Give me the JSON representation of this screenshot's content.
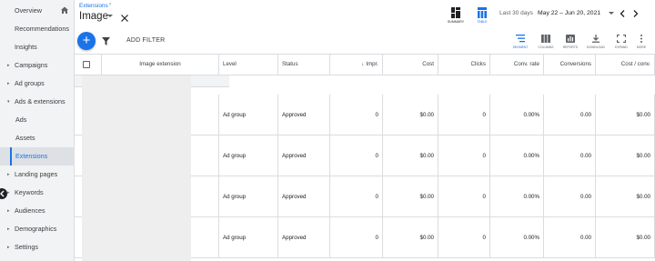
{
  "sidebar": {
    "items": [
      {
        "label": "Overview",
        "caret": false,
        "active": false
      },
      {
        "label": "Recommendations",
        "caret": false,
        "active": false
      },
      {
        "label": "Insights",
        "caret": false,
        "active": false
      },
      {
        "label": "Campaigns",
        "caret": true,
        "active": false
      },
      {
        "label": "Ad groups",
        "caret": true,
        "active": false
      },
      {
        "label": "Ads & extensions",
        "caret": true,
        "active": false
      },
      {
        "label": "Ads",
        "caret": false,
        "active": false
      },
      {
        "label": "Assets",
        "caret": false,
        "active": false
      },
      {
        "label": "Extensions",
        "caret": false,
        "active": true
      },
      {
        "label": "Landing pages",
        "caret": true,
        "active": false
      },
      {
        "label": "Keywords",
        "caret": true,
        "active": false
      },
      {
        "label": "Audiences",
        "caret": true,
        "active": false
      },
      {
        "label": "Demographics",
        "caret": true,
        "active": false
      },
      {
        "label": "Settings",
        "caret": true,
        "active": false
      }
    ]
  },
  "header": {
    "breadcrumb": "Extensions",
    "title": "Image",
    "views": {
      "summary": "SUMMARY",
      "table": "TABLE"
    },
    "date_label": "Last 30 days",
    "date_range": "May 22 – Jun 20, 2021"
  },
  "toolbar": {
    "add_filter": "ADD FILTER",
    "tools": {
      "segment": "SEGMENT",
      "columns": "COLUMNS",
      "reports": "REPORTS",
      "download": "DOWNLOAD",
      "expand": "EXPAND",
      "more": "MORE"
    }
  },
  "table": {
    "headers": {
      "extension": "Image extension",
      "level": "Level",
      "status": "Status",
      "impr": "Impr.",
      "cost": "Cost",
      "clicks": "Clicks",
      "conv_rate": "Conv. rate",
      "conversions": "Conversions",
      "cost_conv": "Cost / conv."
    },
    "rows": [
      {
        "level": "Ad group",
        "status": "Approved",
        "impr": "0",
        "cost": "$0.00",
        "clicks": "0",
        "conv_rate": "0.00%",
        "conversions": "0.00",
        "cost_conv": "$0.00"
      },
      {
        "level": "Ad group",
        "status": "Approved",
        "impr": "0",
        "cost": "$0.00",
        "clicks": "0",
        "conv_rate": "0.00%",
        "conversions": "0.00",
        "cost_conv": "$0.00"
      },
      {
        "level": "Ad group",
        "status": "Approved",
        "impr": "0",
        "cost": "$0.00",
        "clicks": "0",
        "conv_rate": "0.00%",
        "conversions": "0.00",
        "cost_conv": "$0.00"
      },
      {
        "level": "Ad group",
        "status": "Approved",
        "impr": "0",
        "cost": "$0.00",
        "clicks": "0",
        "conv_rate": "0.00%",
        "conversions": "0.00",
        "cost_conv": "$0.00"
      }
    ]
  },
  "colors": {
    "accent": "#1a73e8",
    "sidebar_bg": "#f1f3f4",
    "border": "#dadce0"
  }
}
